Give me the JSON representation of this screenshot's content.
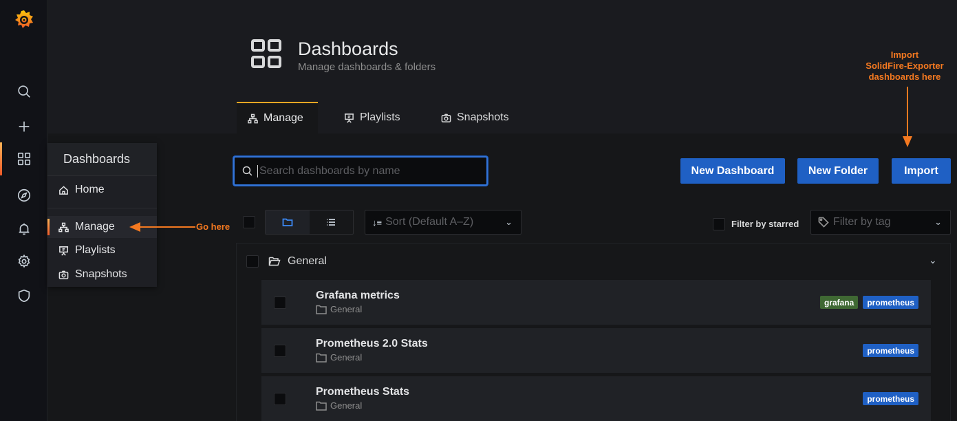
{
  "sidebar": {
    "icons": [
      "grafana-logo",
      "search-icon",
      "plus-icon",
      "dashboards-icon",
      "explore-icon",
      "alerting-icon",
      "gear-icon",
      "shield-icon"
    ]
  },
  "flyout": {
    "title": "Dashboards",
    "items": [
      {
        "label": "Home",
        "icon": "home-icon"
      },
      {
        "label": "Manage",
        "icon": "sitemap-icon"
      },
      {
        "label": "Playlists",
        "icon": "presentation-icon"
      },
      {
        "label": "Snapshots",
        "icon": "camera-icon"
      }
    ]
  },
  "header": {
    "title": "Dashboards",
    "subtitle": "Manage dashboards & folders",
    "tabs": [
      {
        "label": "Manage",
        "icon": "sitemap-icon"
      },
      {
        "label": "Playlists",
        "icon": "presentation-icon"
      },
      {
        "label": "Snapshots",
        "icon": "camera-icon"
      }
    ]
  },
  "toolbar": {
    "search_placeholder": "Search dashboards by name",
    "new_dashboard": "New Dashboard",
    "new_folder": "New Folder",
    "import": "Import",
    "sort": "Sort (Default A–Z)",
    "filter_starred": "Filter by starred",
    "filter_tag": "Filter by tag"
  },
  "list": {
    "folder": "General",
    "dashboards": [
      {
        "name": "Grafana metrics",
        "folder": "General",
        "tags": [
          {
            "label": "grafana",
            "color": "#3f6833"
          },
          {
            "label": "prometheus",
            "color": "#1f60c4"
          }
        ]
      },
      {
        "name": "Prometheus 2.0 Stats",
        "folder": "General",
        "tags": [
          {
            "label": "prometheus",
            "color": "#1f60c4"
          }
        ]
      },
      {
        "name": "Prometheus Stats",
        "folder": "General",
        "tags": [
          {
            "label": "prometheus",
            "color": "#1f60c4"
          }
        ]
      }
    ]
  },
  "annotations": {
    "go_here": "Go here",
    "import_line1": "Import",
    "import_line2": "SolidFire-Exporter",
    "import_line3": "dashboards here"
  },
  "colors": {
    "accent": "#f47920",
    "primary": "#1f60c4"
  }
}
